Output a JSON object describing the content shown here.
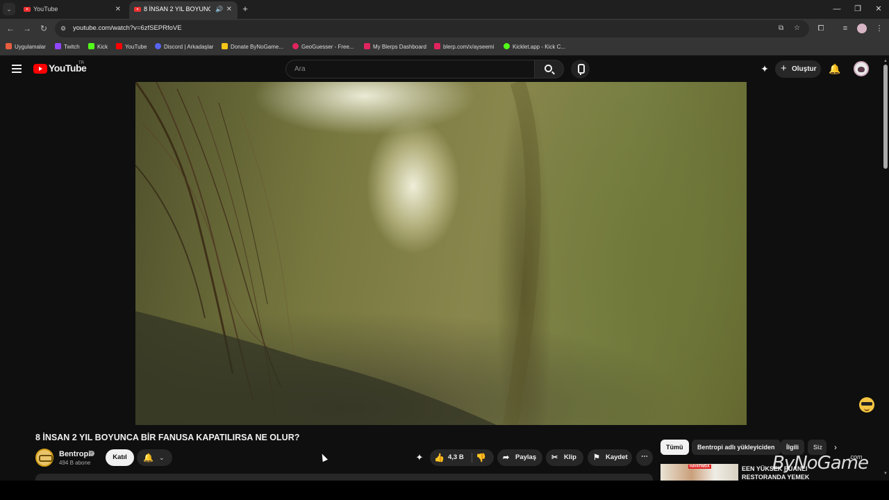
{
  "browser": {
    "tabs": [
      {
        "title": "YouTube",
        "active": false
      },
      {
        "title": "8 İNSAN 2 YIL BOYUNCA BİR FANUSA KAPATILIRSA NE OLUR?",
        "active": true
      }
    ],
    "url": "youtube.com/watch?v=6zfSEPRfoVE",
    "window_controls": {
      "minimize": "—",
      "restore": "❐",
      "close": "✕"
    },
    "bookmarks": [
      {
        "label": "Uygulamalar",
        "icon": "apps-grid-icon",
        "color": "#e85d3f"
      },
      {
        "label": "Twitch",
        "icon": "twitch-icon",
        "color": "#9146ff"
      },
      {
        "label": "Kick",
        "icon": "kick-icon",
        "color": "#53fc18"
      },
      {
        "label": "YouTube",
        "icon": "youtube-icon",
        "color": "#ff0000"
      },
      {
        "label": "Discord | Arkadaşlar",
        "icon": "discord-icon",
        "color": "#5865f2"
      },
      {
        "label": "Donate ByNoGame...",
        "icon": "bynogame-icon",
        "color": "#f5c518"
      },
      {
        "label": "GeoGuesser - Free...",
        "icon": "geoguessr-icon",
        "color": "#e0245e"
      },
      {
        "label": "My Blerps Dashboard",
        "icon": "blerp-icon",
        "color": "#e0245e"
      },
      {
        "label": "blerp.com/x/ayseemi",
        "icon": "blerp-icon",
        "color": "#e0245e"
      },
      {
        "label": "Kicklet.app - Kick C...",
        "icon": "kicklet-icon",
        "color": "#53fc18"
      }
    ]
  },
  "youtube": {
    "logo_text": "YouTube",
    "country": "TR",
    "search_placeholder": "Ara",
    "create_label": "Oluştur",
    "video": {
      "title": "8 İNSAN 2 YIL BOYUNCA BİR FANUSA KAPATILIRSA NE OLUR?",
      "channel": "Bentropi",
      "subscribers": "494 B abone",
      "join_label": "Katıl",
      "likes": "4,3 B",
      "share_label": "Paylaş",
      "clip_label": "Klip",
      "save_label": "Kaydet"
    },
    "chips": [
      "Tümü",
      "Bentropi adlı yükleyiciden",
      "İlgili",
      "Siz"
    ],
    "recommendation": {
      "title": "EEN YÜKSEK PUANLI RESTORANDA YEMEK",
      "thumb_badge": "HAYATIMDA"
    },
    "watermark": "ByNoGame",
    "watermark_suffix": ".com"
  },
  "colors": {
    "page_bg": "#0f0f0f",
    "brand_red": "#ff0000",
    "chrome_bar": "#353535"
  }
}
